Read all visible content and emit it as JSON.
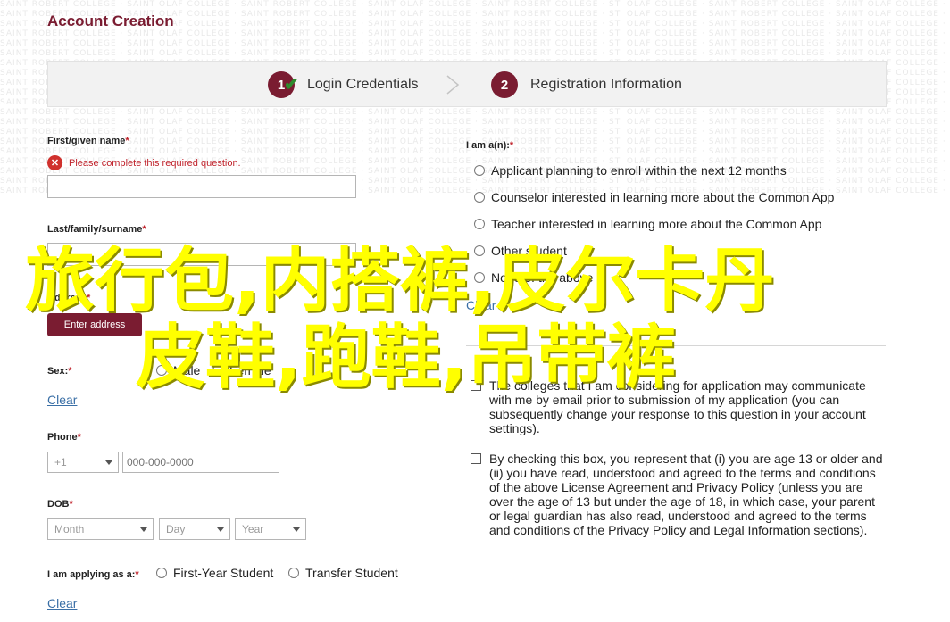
{
  "header": {
    "title": "Account Creation",
    "watermark_text": "SAINT ROBERT COLLEGE · SAINT OLAF COLLEGE · SAINT ROBERT COLLEGE · SAINT OLAF COLLEGE · SAINT ROBERT COLLEGE · ST. OLAF COLLEGE · SAINT ROBERT COLLEGE · SAINT OLAF COLLEGE · SAINT ROBERT COLLEGE"
  },
  "steps": [
    {
      "number": "1",
      "label": "Login Credentials",
      "completed": true
    },
    {
      "number": "2",
      "label": "Registration Information",
      "completed": false
    }
  ],
  "form": {
    "first_name": {
      "label": "First/given name",
      "required": "*",
      "error": "Please complete this required question.",
      "value": ""
    },
    "last_name": {
      "label": "Last/family/surname",
      "required": "*",
      "value": ""
    },
    "address": {
      "label": "Address",
      "required": "*",
      "button": "Enter address"
    },
    "sex": {
      "label": "Sex:",
      "required": "*",
      "options": [
        "Male",
        "Female"
      ],
      "clear": "Clear"
    },
    "phone": {
      "label": "Phone",
      "required": "*",
      "country_code": "+1",
      "placeholder": "000-000-0000"
    },
    "dob": {
      "label": "DOB",
      "required": "*",
      "month": "Month",
      "day": "Day",
      "year": "Year"
    },
    "applying_as": {
      "label": "I am applying as a:",
      "required": "*",
      "options": [
        "First-Year Student",
        "Transfer Student"
      ],
      "clear": "Clear"
    },
    "i_am_a": {
      "label": "I am a(n):",
      "required": "*",
      "options": [
        "Applicant planning to enroll within the next 12 months",
        "Counselor interested in learning more about the Common App",
        "Teacher interested in learning more about the Common App",
        "Other student",
        "None of the above"
      ],
      "clear": "Clear"
    },
    "consent_communicate": "The colleges that I am considering for application may communicate with me by email prior to submission of my application (you can subsequently change your response to this question in your account settings).",
    "consent_age": "By checking this box, you represent that (i) you are age 13 or older and (ii) you have read, understood and agreed to the terms and conditions of the above License Agreement and Privacy Policy (unless you are over the age of 13 but under the age of 18, in which case, your parent or legal guardian has also read, understood and agreed to the terms and conditions of the Privacy Policy and Legal Information sections)."
  },
  "overlay": {
    "line1": "旅行包,内搭裤,皮尔卡丹",
    "line2": "皮鞋,跑鞋,吊带裤"
  },
  "colors": {
    "brand": "#7a1c31",
    "error": "#c0232c",
    "link": "#3a6fa6",
    "overlay": "#ffff00"
  }
}
